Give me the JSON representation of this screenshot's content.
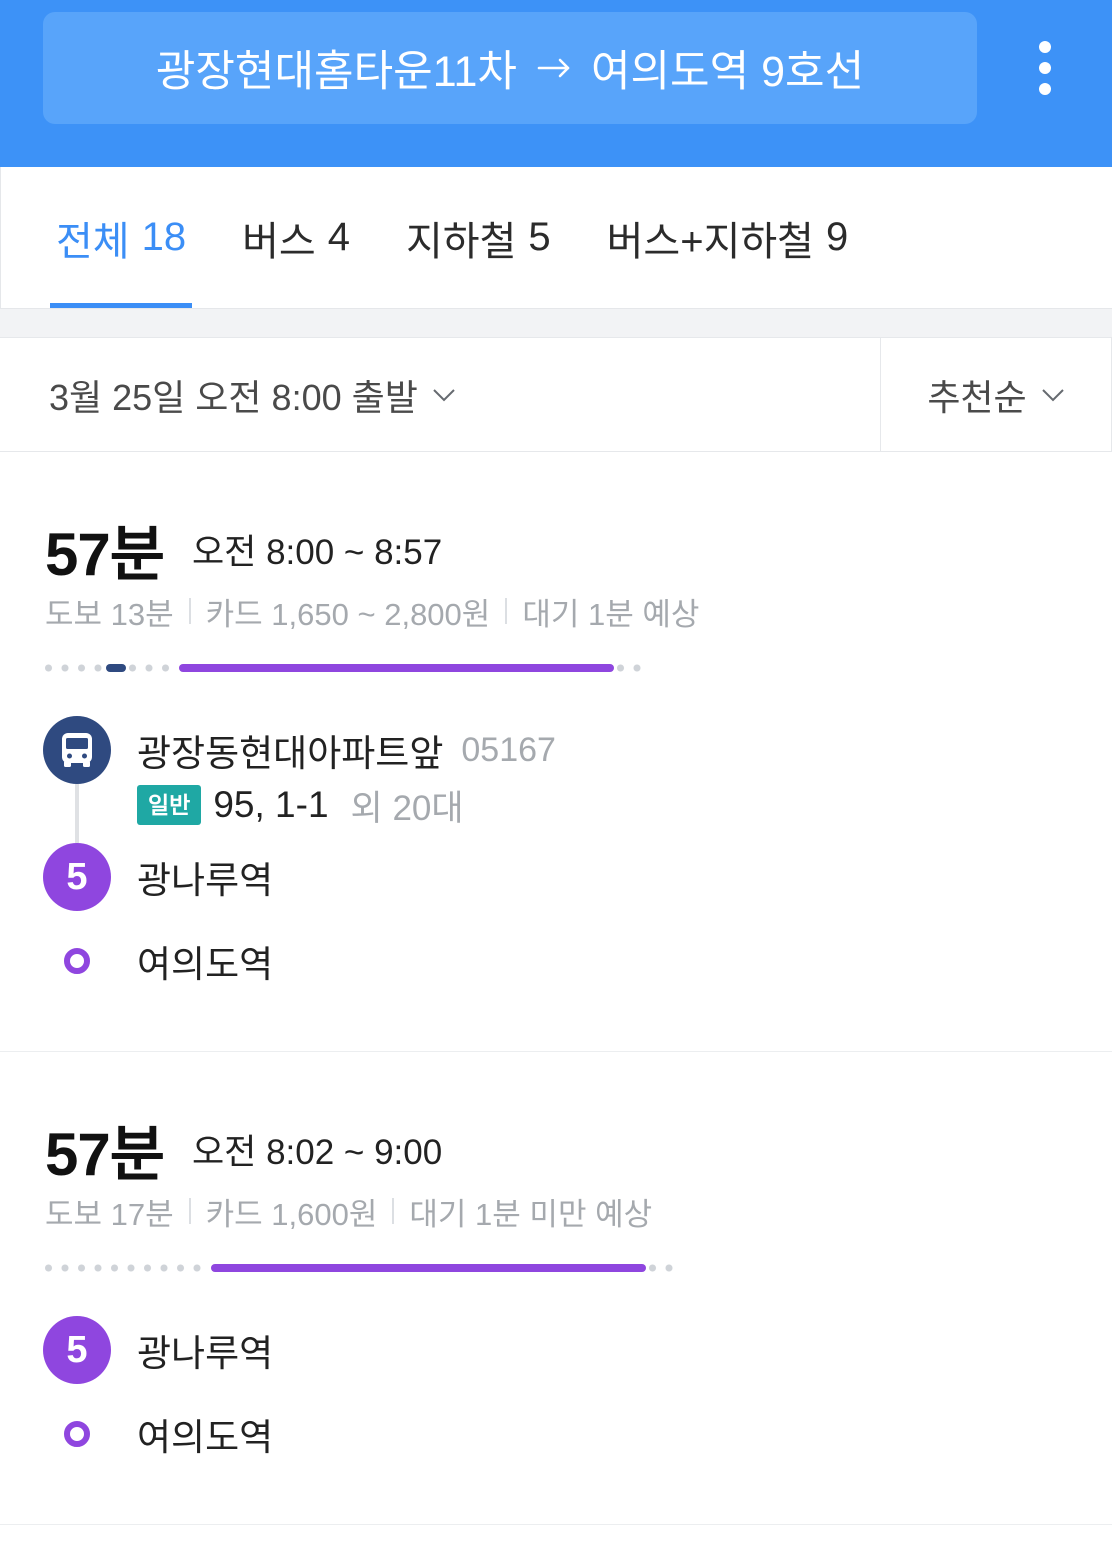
{
  "header": {
    "origin": "광장현대홈타운11차",
    "destination": "여의도역 9호선",
    "arrow_icon": "arrow-right-icon",
    "menu_icon": "more-vertical-icon"
  },
  "tabs": [
    {
      "label": "전체",
      "count": "18",
      "active": true
    },
    {
      "label": "버스",
      "count": "4",
      "active": false
    },
    {
      "label": "지하철",
      "count": "5",
      "active": false
    },
    {
      "label": "버스+지하철",
      "count": "9",
      "active": false
    }
  ],
  "filter": {
    "departure": "3월 25일 오전 8:00 출발",
    "sort": "추천순",
    "dropdown_icon": "chevron-down-icon"
  },
  "colors": {
    "header_background": "#3d92f7",
    "accent": "#3b8ef6",
    "bus": "#2f4a80",
    "subway_line_5": "#8f46df",
    "walk_dots": "#cfd3d8",
    "general_bus_badge": "#1fa8a4"
  },
  "routes": [
    {
      "duration": "57분",
      "time_range": "오전 8:00 ~ 8:57",
      "walk": "도보 13분",
      "fare": "카드 1,650 ~ 2,800원",
      "wait": "대기 1분 예상",
      "segments": [
        {
          "minutes": 5.5,
          "color": "#cfd3d8",
          "dotted": true
        },
        {
          "minutes": 2.5,
          "color": "#2f4a80",
          "dotted": false
        },
        {
          "minutes": 4.5,
          "color": "#cfd3d8",
          "dotted": true
        },
        {
          "minutes": 42,
          "color": "#8f46df",
          "dotted": false
        },
        {
          "minutes": 2.5,
          "color": "#cfd3d8",
          "dotted": true
        }
      ],
      "steps": [
        {
          "icon": "bus-icon",
          "name": "광장동현대아파트앞",
          "stop_id": "05167",
          "bus_type": "일반",
          "bus_lines": "95, 1-1",
          "more": "외 20대"
        },
        {
          "line": "5",
          "name": "광나루역"
        },
        {
          "icon": "destination-dot-icon",
          "name": "여의도역"
        }
      ]
    },
    {
      "duration": "57분",
      "time_range": "오전 8:02 ~ 9:00",
      "walk": "도보 17분",
      "fare": "카드 1,600원",
      "wait": "대기 1분 미만 예상",
      "segments": [
        {
          "minutes": 15.5,
          "color": "#cfd3d8",
          "dotted": true
        },
        {
          "minutes": 42,
          "color": "#8f46df",
          "dotted": false
        },
        {
          "minutes": 2.5,
          "color": "#cfd3d8",
          "dotted": true
        }
      ],
      "steps": [
        {
          "line": "5",
          "name": "광나루역"
        },
        {
          "icon": "destination-dot-icon",
          "name": "여의도역"
        }
      ]
    }
  ]
}
